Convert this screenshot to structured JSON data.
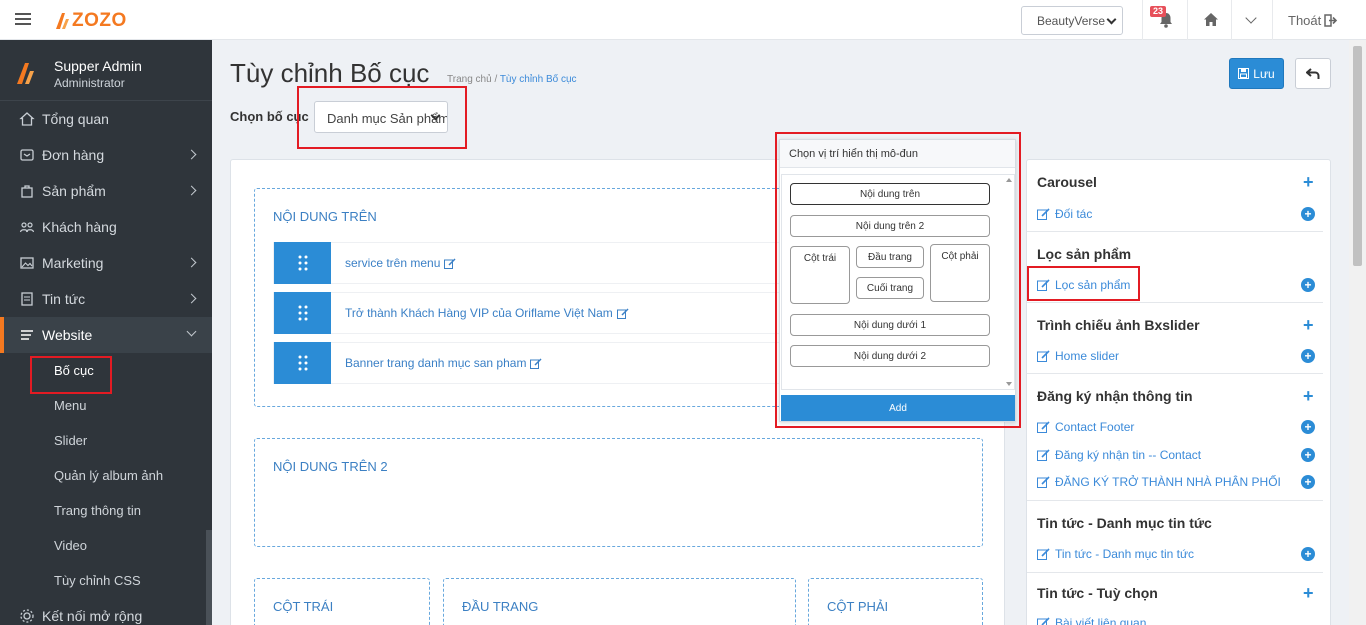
{
  "topbar": {
    "logo_text": "ZOZO",
    "store_select": "BeautyVerse",
    "notification_count": "23",
    "logout_label": "Thoát"
  },
  "sidebar": {
    "user_name": "Supper Admin",
    "user_role": "Administrator",
    "items": [
      {
        "label": "Tổng quan",
        "icon": "home-icon",
        "has_chevron": false
      },
      {
        "label": "Đơn hàng",
        "icon": "inbox-icon",
        "has_chevron": true
      },
      {
        "label": "Sản phẩm",
        "icon": "bag-icon",
        "has_chevron": true
      },
      {
        "label": "Khách hàng",
        "icon": "users-icon",
        "has_chevron": false
      },
      {
        "label": "Marketing",
        "icon": "image-icon",
        "has_chevron": true
      },
      {
        "label": "Tin tức",
        "icon": "document-icon",
        "has_chevron": true
      },
      {
        "label": "Website",
        "icon": "menu-lines-icon",
        "has_chevron": true
      }
    ],
    "sub_items": [
      "Bố cục",
      "Menu",
      "Slider",
      "Quản lý album ảnh",
      "Trang thông tin",
      "Video",
      "Tùy chỉnh CSS"
    ],
    "last_item": "Kết nối mở rộng"
  },
  "header": {
    "title": "Tùy chỉnh Bố cục",
    "breadcrumb_home": "Trang chủ",
    "breadcrumb_sep": "/",
    "breadcrumb_current": "Tùy chỉnh Bố cục",
    "save_label": "Lưu",
    "layout_label": "Chọn bố cục",
    "layout_value": "Danh mục Sản phẩm"
  },
  "zones": {
    "top": {
      "title": "NỘI DUNG TRÊN",
      "modules": [
        "service trên menu",
        "Trở thành Khách Hàng VIP của Oriflame Việt Nam",
        "Banner trang danh mục san pham"
      ]
    },
    "top2": {
      "title": "NỘI DUNG TRÊN 2"
    },
    "left": {
      "title": "CỘT TRÁI"
    },
    "header": {
      "title": "ĐẦU TRANG"
    },
    "right": {
      "title": "CỘT PHẢI"
    }
  },
  "popup": {
    "title": "Chọn vị trí hiển thị mô-đun",
    "positions": {
      "top": "Nội dung trên",
      "top2": "Nội dung trên 2",
      "left": "Cột trái",
      "header": "Đầu trang",
      "footer": "Cuối trang",
      "right": "Cột phải",
      "bottom1": "Nội dung dưới 1",
      "bottom2": "Nội dung dưới 2"
    },
    "add_label": "Add"
  },
  "modules_panel": {
    "sections": [
      {
        "title": "Carousel",
        "items": [
          "Đối tác"
        ]
      },
      {
        "title": "Lọc sản phẩm",
        "items": [
          "Lọc sản phẩm"
        ]
      },
      {
        "title": "Trình chiếu ảnh Bxslider",
        "items": [
          "Home slider"
        ]
      },
      {
        "title": "Đăng ký nhận thông tin",
        "items": [
          "Contact Footer",
          "Đăng ký nhận tin -- Contact",
          "ĐĂNG KÝ TRỞ THÀNH NHÀ PHÂN PHỐI"
        ]
      },
      {
        "title": "Tin tức - Danh mục tin tức",
        "items": [
          "Tin tức - Danh mục tin tức"
        ]
      },
      {
        "title": "Tin tức - Tuỳ chọn",
        "items": [
          "Bài viết liên quan"
        ]
      }
    ]
  },
  "colors": {
    "accent_blue": "#2b8cd6",
    "brand_orange": "#f47920",
    "highlight_red": "#e31b23",
    "sidebar_bg": "#2f353b"
  }
}
